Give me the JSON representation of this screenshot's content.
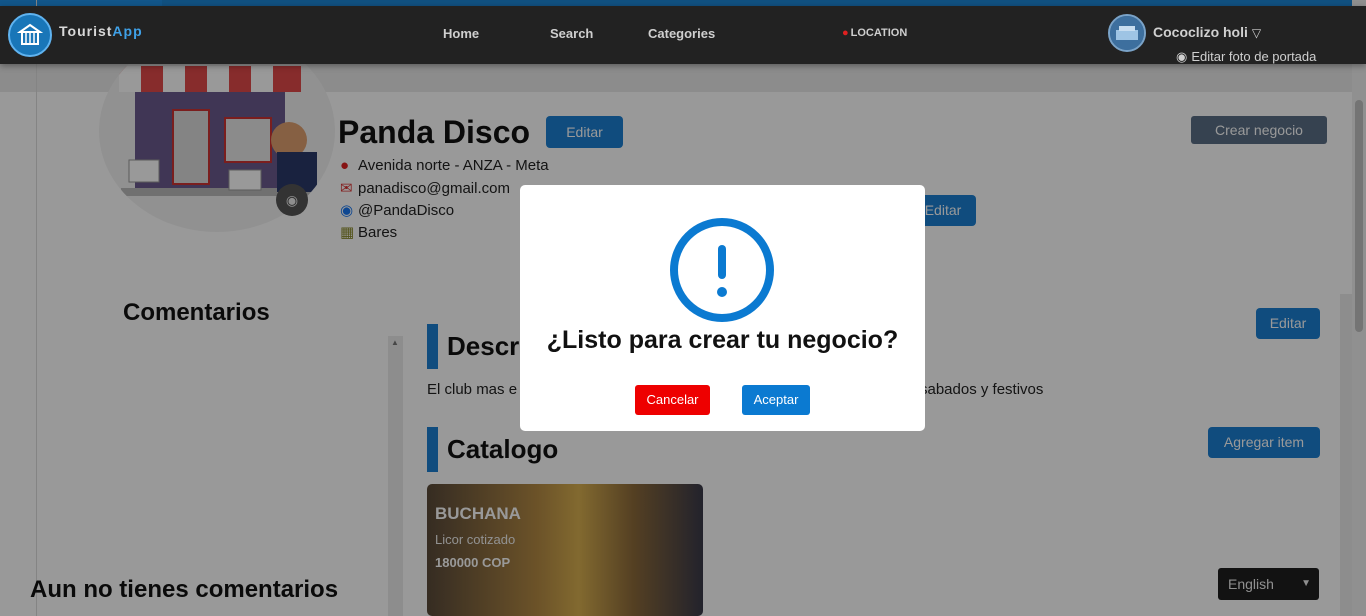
{
  "navbar": {
    "brand_name": "Tourist",
    "brand_suffix": "App",
    "links": [
      "Home",
      "Search",
      "Categories"
    ],
    "location_label": "LOCATION",
    "user_name": "Cococlizo holi",
    "user_caret": "▽",
    "cover_edit_label": "Editar foto de portada"
  },
  "business": {
    "name": "Panda Disco",
    "edit_name_label": "Editar",
    "create_label": "Crear negocio",
    "address": "Avenida norte - ANZA - Meta",
    "email": "panadisco@gmail.com",
    "facebook": "@PandaDisco",
    "category": "Bares",
    "edit_info_label": "Editar"
  },
  "comments": {
    "title": "Comentarios",
    "empty_text": "Aun no tienes comentarios"
  },
  "description": {
    "title": "Descr",
    "text_start": "El club mas e",
    "text_end": "sabados y festivos",
    "edit_label": "Editar"
  },
  "catalog": {
    "title": "Catalogo",
    "add_label": "Agregar item",
    "items": [
      {
        "title": "BUCHANA",
        "description": "Licor cotizado",
        "price": "180000 COP"
      }
    ]
  },
  "language": {
    "selected": "English"
  },
  "modal": {
    "icon": "exclamation-circle-icon",
    "title": "¿Listo para crear tu negocio?",
    "cancel_label": "Cancelar",
    "accept_label": "Aceptar"
  },
  "colors": {
    "primary": "#1b7fd3",
    "danger": "#ee0000",
    "modal_icon": "#0b7ad1"
  }
}
